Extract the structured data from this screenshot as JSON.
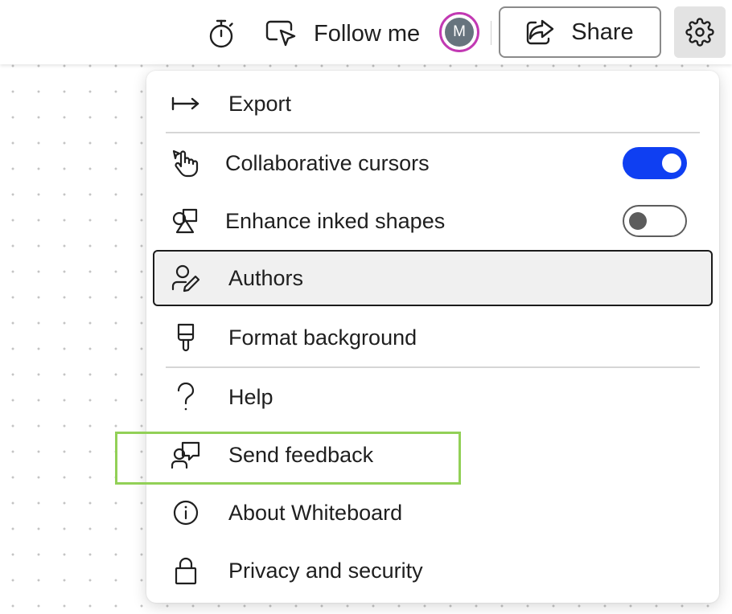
{
  "toolbar": {
    "timer_icon": "stopwatch-icon",
    "follow_icon": "presenter-pointer-icon",
    "follow_label": "Follow me",
    "avatar_initial": "M",
    "avatar_ring_color": "#c239b3",
    "share_icon": "share-arrow-icon",
    "share_label": "Share",
    "settings_icon": "gear-icon"
  },
  "menu": {
    "items": [
      {
        "id": "export",
        "label": "Export",
        "icon": "export-arrow-icon"
      },
      {
        "id": "collaborative-cursors",
        "label": "Collaborative cursors",
        "icon": "hand-pointer-icon",
        "toggle": true,
        "toggle_on": true
      },
      {
        "id": "enhance-inked-shapes",
        "label": "Enhance inked shapes",
        "icon": "shapes-icon",
        "toggle": true,
        "toggle_on": false
      },
      {
        "id": "authors",
        "label": "Authors",
        "icon": "person-edit-icon",
        "selected": true
      },
      {
        "id": "format-background",
        "label": "Format background",
        "icon": "paint-brush-icon"
      },
      {
        "id": "help",
        "label": "Help",
        "icon": "question-mark-icon"
      },
      {
        "id": "send-feedback",
        "label": "Send feedback",
        "icon": "person-feedback-icon"
      },
      {
        "id": "about-whiteboard",
        "label": "About Whiteboard",
        "icon": "info-circle-icon"
      },
      {
        "id": "privacy-and-security",
        "label": "Privacy and security",
        "icon": "lock-icon"
      }
    ]
  },
  "colors": {
    "toggle_on": "#0f3ff2",
    "highlight": "#92d057"
  }
}
